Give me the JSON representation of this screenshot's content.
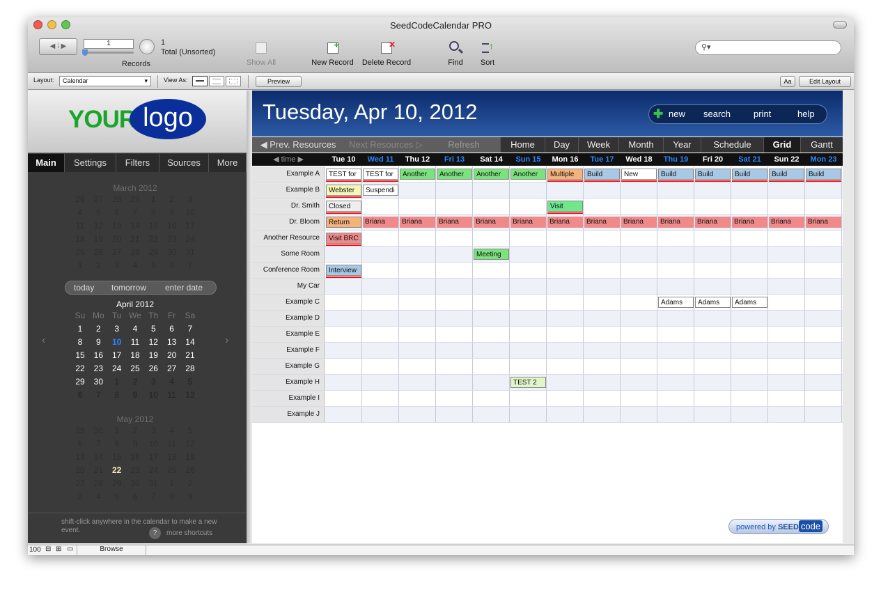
{
  "app": {
    "title": "SeedCodeCalendar PRO"
  },
  "toolbar": {
    "record_value": "1",
    "record_count": "1",
    "record_status": "Total (Unsorted)",
    "records_label": "Records",
    "show_all": "Show All",
    "new_record": "New Record",
    "delete_record": "Delete Record",
    "find": "Find",
    "sort": "Sort"
  },
  "layoutbar": {
    "layout_label": "Layout:",
    "layout_value": "Calendar",
    "view_as": "View As:",
    "preview": "Preview",
    "aa": "Aa",
    "edit_layout": "Edit Layout"
  },
  "sidebar": {
    "logo_left": "YOUR",
    "logo_right": "logo",
    "tabs": [
      "Main",
      "Settings",
      "Filters",
      "Sources",
      "More"
    ],
    "months": {
      "m1": "March 2012",
      "m2": "April 2012",
      "m3": "May 2012"
    },
    "dow": [
      "Su",
      "Mo",
      "Tu",
      "We",
      "Th",
      "Fr",
      "Sa"
    ],
    "mar": [
      [
        "26",
        "27",
        "28",
        "29",
        "1",
        "2",
        "3"
      ],
      [
        "4",
        "5",
        "6",
        "7",
        "8",
        "9",
        "10"
      ],
      [
        "11",
        "12",
        "13",
        "14",
        "15",
        "16",
        "17"
      ],
      [
        "18",
        "19",
        "20",
        "21",
        "22",
        "23",
        "24"
      ],
      [
        "25",
        "26",
        "27",
        "28",
        "29",
        "30",
        "31"
      ],
      [
        "1",
        "2",
        "3",
        "4",
        "5",
        "6",
        "7"
      ]
    ],
    "apr": [
      [
        "1",
        "2",
        "3",
        "4",
        "5",
        "6",
        "7"
      ],
      [
        "8",
        "9",
        "10",
        "11",
        "12",
        "13",
        "14"
      ],
      [
        "15",
        "16",
        "17",
        "18",
        "19",
        "20",
        "21"
      ],
      [
        "22",
        "23",
        "24",
        "25",
        "26",
        "27",
        "28"
      ],
      [
        "29",
        "30",
        "1",
        "2",
        "3",
        "4",
        "5"
      ],
      [
        "6",
        "7",
        "8",
        "9",
        "10",
        "11",
        "12"
      ]
    ],
    "may": [
      [
        "29",
        "30",
        "1",
        "2",
        "3",
        "4",
        "5"
      ],
      [
        "6",
        "7",
        "8",
        "9",
        "10",
        "11",
        "12"
      ],
      [
        "13",
        "14",
        "15",
        "16",
        "17",
        "18",
        "19"
      ],
      [
        "20",
        "21",
        "22",
        "23",
        "24",
        "25",
        "26"
      ],
      [
        "27",
        "28",
        "29",
        "30",
        "31",
        "1",
        "2"
      ],
      [
        "3",
        "4",
        "5",
        "6",
        "7",
        "8",
        "9"
      ]
    ],
    "quick": [
      "today",
      "tomorrow",
      "enter date"
    ],
    "hint": "shift-click anywhere in the calendar to make a new event.",
    "shortcuts": "more shortcuts",
    "help": "?"
  },
  "header": {
    "date": "Tuesday, Apr 10, 2012",
    "new": "new",
    "search": "search",
    "print": "print",
    "help": "help"
  },
  "nav": {
    "prev": "Prev. Resources",
    "next": "Next Resources",
    "refresh": "Refresh",
    "views": [
      "Home",
      "Day",
      "Week",
      "Month",
      "Year",
      "Schedule",
      "Grid",
      "Gantt"
    ]
  },
  "timecol": "time",
  "days": [
    "Tue 10",
    "Wed 11",
    "Thu 12",
    "Fri 13",
    "Sat 14",
    "Sun 15",
    "Mon 16",
    "Tue 17",
    "Wed 18",
    "Thu 19",
    "Fri 20",
    "Sat 21",
    "Sun 22",
    "Mon 23"
  ],
  "resources": [
    "Example A",
    "Example B",
    "Dr. Smith",
    "Dr. Bloom",
    "Another Resource",
    "Some Room",
    "Conference Room",
    "My Car",
    "Example C",
    "Example D",
    "Example E",
    "Example F",
    "Example G",
    "Example H",
    "Example I",
    "Example J"
  ],
  "events": [
    {
      "r": 0,
      "d": 0,
      "t": "TEST for",
      "c": "#ffffff",
      "u": true
    },
    {
      "r": 0,
      "d": 1,
      "t": "TEST for",
      "c": "#ffffff",
      "u": true
    },
    {
      "r": 0,
      "d": 2,
      "t": "Another",
      "c": "#7be37b"
    },
    {
      "r": 0,
      "d": 3,
      "t": "Another",
      "c": "#7be37b"
    },
    {
      "r": 0,
      "d": 4,
      "t": "Another",
      "c": "#7be37b"
    },
    {
      "r": 0,
      "d": 5,
      "t": "Another",
      "c": "#7be37b"
    },
    {
      "r": 0,
      "d": 6,
      "t": "Multiple",
      "c": "#f5b27a",
      "u": true
    },
    {
      "r": 0,
      "d": 7,
      "t": "Build",
      "c": "#a9c8e6",
      "u": true
    },
    {
      "r": 0,
      "d": 8,
      "t": "New",
      "c": "#ffffff",
      "u": true
    },
    {
      "r": 0,
      "d": 9,
      "t": "Build",
      "c": "#a9c8e6",
      "u": true
    },
    {
      "r": 0,
      "d": 10,
      "t": "Build",
      "c": "#a9c8e6",
      "u": true
    },
    {
      "r": 0,
      "d": 11,
      "t": "Build",
      "c": "#a9c8e6",
      "u": true
    },
    {
      "r": 0,
      "d": 12,
      "t": "Build",
      "c": "#a9c8e6",
      "u": true
    },
    {
      "r": 0,
      "d": 13,
      "t": "Build",
      "c": "#a9c8e6",
      "u": true
    },
    {
      "r": 1,
      "d": 0,
      "t": "Webster",
      "c": "#f3f7b8",
      "u": true
    },
    {
      "r": 1,
      "d": 1,
      "t": "Suspendi",
      "c": "#ffffff"
    },
    {
      "r": 2,
      "d": 0,
      "t": "Closed",
      "c": "#eeeeee",
      "u": true
    },
    {
      "r": 2,
      "d": 6,
      "t": "Visit",
      "c": "#6ee88a",
      "u": true
    },
    {
      "r": 3,
      "d": 0,
      "t": "Return",
      "c": "#f5b27a"
    },
    {
      "r": 3,
      "d": 1,
      "t": "Briana",
      "c": "#f08a8a"
    },
    {
      "r": 3,
      "d": 2,
      "t": "Briana",
      "c": "#f08a8a"
    },
    {
      "r": 3,
      "d": 3,
      "t": "Briana",
      "c": "#f08a8a"
    },
    {
      "r": 3,
      "d": 4,
      "t": "Briana",
      "c": "#f08a8a"
    },
    {
      "r": 3,
      "d": 5,
      "t": "Briana",
      "c": "#f08a8a"
    },
    {
      "r": 3,
      "d": 6,
      "t": "Briana",
      "c": "#f08a8a"
    },
    {
      "r": 3,
      "d": 7,
      "t": "Briana",
      "c": "#f08a8a"
    },
    {
      "r": 3,
      "d": 8,
      "t": "Briana",
      "c": "#f08a8a"
    },
    {
      "r": 3,
      "d": 9,
      "t": "Briana",
      "c": "#f08a8a"
    },
    {
      "r": 3,
      "d": 10,
      "t": "Briana",
      "c": "#f08a8a"
    },
    {
      "r": 3,
      "d": 11,
      "t": "Briana",
      "c": "#f08a8a"
    },
    {
      "r": 3,
      "d": 12,
      "t": "Briana",
      "c": "#f08a8a"
    },
    {
      "r": 3,
      "d": 13,
      "t": "Briana",
      "c": "#f08a8a"
    },
    {
      "r": 4,
      "d": 0,
      "t": "Visit BRC",
      "c": "#f08a8a",
      "u": true
    },
    {
      "r": 5,
      "d": 4,
      "t": "Meeting",
      "c": "#7be37b"
    },
    {
      "r": 6,
      "d": 0,
      "t": "Interview",
      "c": "#a9c8e6",
      "u": true
    },
    {
      "r": 8,
      "d": 9,
      "t": "Adams",
      "c": "#ffffff"
    },
    {
      "r": 8,
      "d": 10,
      "t": "Adams",
      "c": "#ffffff"
    },
    {
      "r": 8,
      "d": 11,
      "t": "Adams",
      "c": "#ffffff"
    },
    {
      "r": 13,
      "d": 5,
      "t": "TEST 2",
      "c": "#e0f5c8"
    }
  ],
  "footer": {
    "powered": "powered by",
    "brand1": "SEED",
    "brand2": "code"
  },
  "status": {
    "zoom": "100",
    "mode": "Browse"
  },
  "colors": {
    "accent": "#2a86ff",
    "header": "#0b2b6b",
    "weekend_blue": "#2a86ff"
  }
}
